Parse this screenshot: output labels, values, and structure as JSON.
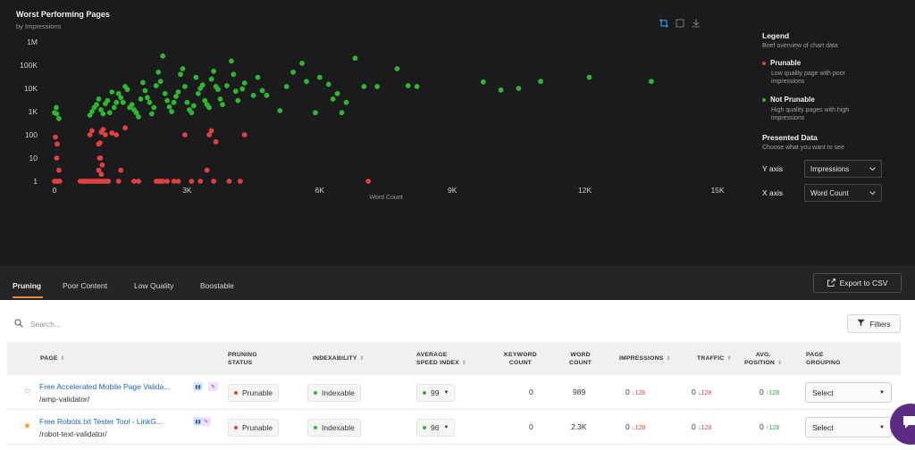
{
  "chart": {
    "title": "Worst Performing Pages",
    "subtitle": "by Impressions"
  },
  "legend": {
    "title": "Legend",
    "subtitle": "Brief overview of chart data",
    "prunable_label": "Prunable",
    "prunable_desc": "Low quality page with poor impressions",
    "not_prunable_label": "Not Prunable",
    "not_prunable_desc": "High quality pages with high impressions",
    "presented_title": "Presented Data",
    "presented_subtitle": "Choose what you want to see",
    "y_axis_label": "Y axis",
    "y_axis_value": "Impressions",
    "x_axis_label": "X axis",
    "x_axis_value": "Word Count"
  },
  "colors": {
    "prunable": "#e04040",
    "not_prunable": "#2fb52f",
    "accent": "#e8883a",
    "link": "#1f62b8"
  },
  "chart_data": {
    "type": "scatter",
    "title": "Worst Performing Pages",
    "subtitle": "by Impressions",
    "xlabel": "Word Count",
    "ylabel": "",
    "xlim": [
      0,
      15000
    ],
    "ylim": [
      1,
      1000000
    ],
    "yscale": "log",
    "x_ticks": [
      "0",
      "3K",
      "6K",
      "9K",
      "12K",
      "15K"
    ],
    "y_ticks": [
      "1",
      "10",
      "100",
      "1K",
      "10K",
      "100K",
      "1M"
    ],
    "grid": false,
    "legend_position": "right",
    "series": [
      {
        "name": "Prunable",
        "color": "#e04040",
        "points": [
          [
            0,
            1
          ],
          [
            40,
            1
          ],
          [
            80,
            1
          ],
          [
            120,
            1
          ],
          [
            20,
            80
          ],
          [
            60,
            40
          ],
          [
            50,
            10
          ],
          [
            100,
            3
          ],
          [
            580,
            1
          ],
          [
            620,
            1
          ],
          [
            660,
            1
          ],
          [
            700,
            1
          ],
          [
            740,
            1
          ],
          [
            780,
            1
          ],
          [
            820,
            1
          ],
          [
            860,
            1
          ],
          [
            900,
            1
          ],
          [
            940,
            1
          ],
          [
            980,
            1
          ],
          [
            1020,
            1
          ],
          [
            1060,
            1
          ],
          [
            1100,
            1
          ],
          [
            1140,
            1
          ],
          [
            1180,
            1
          ],
          [
            1220,
            1
          ],
          [
            1000,
            3
          ],
          [
            1020,
            10
          ],
          [
            1040,
            10
          ],
          [
            1060,
            2
          ],
          [
            1080,
            5
          ],
          [
            1000,
            40
          ],
          [
            1030,
            45
          ],
          [
            1060,
            130
          ],
          [
            1100,
            170
          ],
          [
            1150,
            100
          ],
          [
            800,
            100
          ],
          [
            850,
            150
          ],
          [
            1300,
            120
          ],
          [
            1400,
            100
          ],
          [
            1450,
            1
          ],
          [
            1500,
            3
          ],
          [
            1600,
            200
          ],
          [
            1800,
            1
          ],
          [
            1900,
            1
          ],
          [
            2300,
            1
          ],
          [
            2350,
            1
          ],
          [
            2400,
            1
          ],
          [
            2450,
            1
          ],
          [
            2550,
            1
          ],
          [
            2700,
            1
          ],
          [
            2800,
            1
          ],
          [
            2950,
            100
          ],
          [
            3100,
            1
          ],
          [
            3300,
            1
          ],
          [
            3450,
            3
          ],
          [
            3600,
            1
          ],
          [
            3500,
            100
          ],
          [
            3550,
            150
          ],
          [
            3650,
            50
          ],
          [
            4300,
            100
          ],
          [
            3950,
            1
          ],
          [
            4200,
            1
          ],
          [
            7100,
            1
          ]
        ]
      },
      {
        "name": "Not Prunable",
        "color": "#2fb52f",
        "points": [
          [
            0,
            900
          ],
          [
            50,
            800
          ],
          [
            100,
            500
          ],
          [
            40,
            1500
          ],
          [
            800,
            700
          ],
          [
            850,
            1000
          ],
          [
            900,
            1500
          ],
          [
            950,
            2000
          ],
          [
            1000,
            3500
          ],
          [
            1050,
            1200
          ],
          [
            1100,
            800
          ],
          [
            1150,
            2200
          ],
          [
            1200,
            3000
          ],
          [
            1250,
            900
          ],
          [
            1300,
            7000
          ],
          [
            1350,
            1500
          ],
          [
            1400,
            2500
          ],
          [
            1450,
            6000
          ],
          [
            1500,
            4000
          ],
          [
            1550,
            2500
          ],
          [
            1600,
            12000
          ],
          [
            1650,
            9000
          ],
          [
            1700,
            1500
          ],
          [
            1750,
            2000
          ],
          [
            1800,
            1200
          ],
          [
            1850,
            900
          ],
          [
            1900,
            600
          ],
          [
            1950,
            3500
          ],
          [
            2000,
            18000
          ],
          [
            2050,
            8000
          ],
          [
            2100,
            4000
          ],
          [
            2150,
            2500
          ],
          [
            2200,
            800
          ],
          [
            2250,
            1500
          ],
          [
            2300,
            13000
          ],
          [
            2350,
            50000
          ],
          [
            2400,
            20000
          ],
          [
            2450,
            250000
          ],
          [
            2500,
            6000
          ],
          [
            2550,
            3000
          ],
          [
            2600,
            1600
          ],
          [
            2650,
            1000
          ],
          [
            2700,
            2500
          ],
          [
            2750,
            4500
          ],
          [
            2800,
            7000
          ],
          [
            2850,
            40000
          ],
          [
            2900,
            70000
          ],
          [
            2950,
            12000
          ],
          [
            3000,
            2500
          ],
          [
            3050,
            1200
          ],
          [
            3100,
            900
          ],
          [
            3150,
            1800
          ],
          [
            3200,
            30000
          ],
          [
            3250,
            6000
          ],
          [
            3300,
            10000
          ],
          [
            3350,
            14000
          ],
          [
            3400,
            3000
          ],
          [
            3450,
            2000
          ],
          [
            3500,
            1500
          ],
          [
            3550,
            25000
          ],
          [
            3600,
            55000
          ],
          [
            3650,
            12000
          ],
          [
            3700,
            9000
          ],
          [
            3750,
            3500
          ],
          [
            3800,
            2000
          ],
          [
            3900,
            13000
          ],
          [
            4000,
            150000
          ],
          [
            4050,
            40000
          ],
          [
            4100,
            7500
          ],
          [
            4150,
            3000
          ],
          [
            4250,
            9500
          ],
          [
            4300,
            17000
          ],
          [
            4500,
            5000
          ],
          [
            4600,
            30000
          ],
          [
            4700,
            8000
          ],
          [
            4800,
            5000
          ],
          [
            5100,
            1100
          ],
          [
            5250,
            12000
          ],
          [
            5400,
            50000
          ],
          [
            5600,
            120000
          ],
          [
            5700,
            20000
          ],
          [
            5900,
            900
          ],
          [
            6000,
            30000
          ],
          [
            6200,
            15000
          ],
          [
            6300,
            3500
          ],
          [
            6400,
            6000
          ],
          [
            6500,
            900
          ],
          [
            6600,
            2500
          ],
          [
            6800,
            200000
          ],
          [
            7000,
            12000
          ],
          [
            7300,
            12000
          ],
          [
            7750,
            70000
          ],
          [
            8000,
            13000
          ],
          [
            8200,
            12000
          ],
          [
            9700,
            19000
          ],
          [
            10100,
            8500
          ],
          [
            10500,
            10000
          ],
          [
            11000,
            20000
          ],
          [
            12100,
            30000
          ],
          [
            13500,
            20000
          ]
        ]
      }
    ]
  },
  "tabs": {
    "items": [
      {
        "label": "Pruning"
      },
      {
        "label": "Poor Content"
      },
      {
        "label": "Low Quality"
      },
      {
        "label": "Boostable"
      }
    ],
    "export_label": "Export to CSV"
  },
  "search": {
    "placeholder": "Search..."
  },
  "filters_label": "Filters",
  "table": {
    "columns": {
      "page": "PAGE",
      "pruning_status_1": "PRUNING",
      "pruning_status_2": "STATUS",
      "indexability": "INDEXABILITY",
      "speed_1": "AVERAGE",
      "speed_2": "SPEED INDEX",
      "keyword_1": "KEYWORD",
      "keyword_2": "COUNT",
      "word_1": "WORD",
      "word_2": "COUNT",
      "impressions": "IMPRESSIONS",
      "traffic": "TRAFFIC",
      "position_1": "AVG.",
      "position_2": "POSITION",
      "grouping_1": "PAGE",
      "grouping_2": "GROUPING"
    },
    "rows": [
      {
        "starred": false,
        "title": "Free Accelerated Mobile Page Valida...",
        "path": "/amp-validator/",
        "pruning_status": "Prunable",
        "indexability": "Indexable",
        "speed_index": "99",
        "keyword_count": "0",
        "word_count": "989",
        "impressions": "0",
        "impressions_delta": "128",
        "traffic": "0",
        "traffic_delta": "128",
        "avg_position": "0",
        "avg_position_delta": "128",
        "grouping": "Select"
      },
      {
        "starred": true,
        "title": "Free Robots.txt Tester Tool - LinkG...",
        "path": "/robot-text-validator/",
        "pruning_status": "Prunable",
        "indexability": "Indexable",
        "speed_index": "96",
        "keyword_count": "0",
        "word_count": "2.3K",
        "impressions": "0",
        "impressions_delta": "128",
        "traffic": "0",
        "traffic_delta": "128",
        "avg_position": "0",
        "avg_position_delta": "128",
        "grouping": "Select"
      }
    ]
  }
}
